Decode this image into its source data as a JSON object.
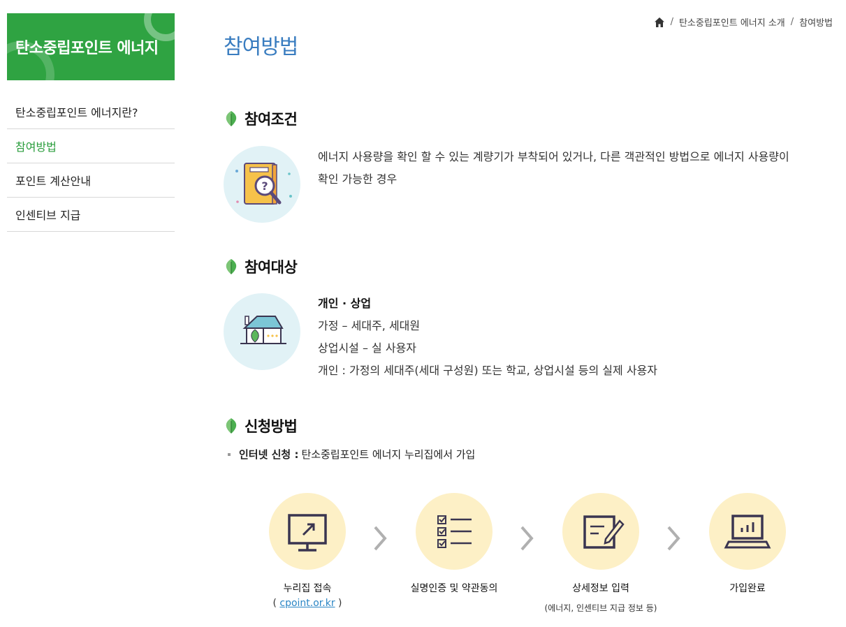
{
  "sidebar": {
    "banner_title": "탄소중립포인트 에너지",
    "items": [
      {
        "label": "탄소중립포인트 에너지란?",
        "active": false
      },
      {
        "label": "참여방법",
        "active": true
      },
      {
        "label": "포인트 계산안내",
        "active": false
      },
      {
        "label": "인센티브 지급",
        "active": false
      }
    ]
  },
  "breadcrumb": {
    "home_icon": "home-icon",
    "items": [
      "탄소중립포인트 에너지 소개",
      "참여방법"
    ]
  },
  "page_title": "참여방법",
  "sections": {
    "condition": {
      "title": "참여조건",
      "icon": "magnifier-book-icon",
      "line1": "에너지 사용량을 확인 할 수 있는 계량기가 부착되어 있거나, 다른 객관적인 방법으로 에너지 사용량이",
      "line2": "확인 가능한 경우"
    },
    "target": {
      "title": "참여대상",
      "icon": "house-leaf-icon",
      "heading": "개인 · 상업",
      "line1": "가정 – 세대주, 세대원",
      "line2": "상업시설 – 실 사용자",
      "line3": "개인 : 가정의 세대주(세대 구성원) 또는 학교, 상업시설 등의 실제 사용자"
    },
    "apply": {
      "title": "신청방법",
      "bullet_strong": "인터넷 신청 :",
      "bullet_text": "탄소중립포인트 에너지 누리집에서 가입",
      "steps": [
        {
          "label": "누리집 접속",
          "sub_prefix": "( ",
          "link": "cpoint.or.kr",
          "sub_suffix": " )",
          "icon": "monitor-link-icon"
        },
        {
          "label": "실명인증 및 약관동의",
          "icon": "checklist-icon"
        },
        {
          "label": "상세정보 입력",
          "sub": "(에너지, 인센티브 지급 정보 등)",
          "icon": "form-edit-icon"
        },
        {
          "label": "가입완료",
          "icon": "laptop-chart-icon"
        }
      ]
    }
  },
  "colors": {
    "brand_green": "#2fa342",
    "title_blue": "#3a7dc0",
    "step_bg": "#fdf0c6",
    "icon_bg": "#e1f2f6"
  }
}
